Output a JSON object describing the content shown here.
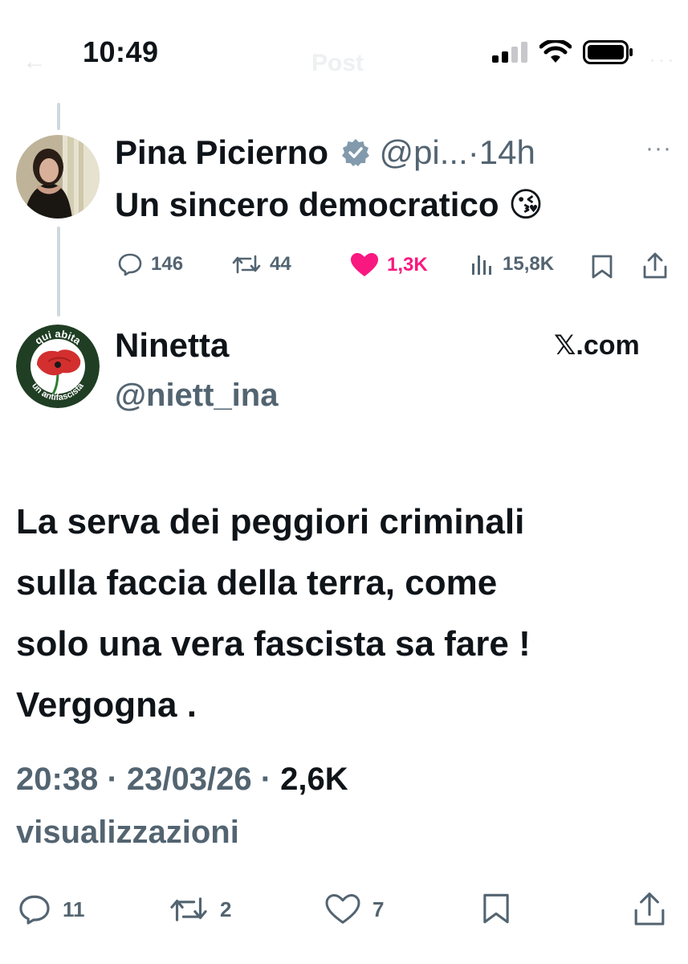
{
  "status_bar": {
    "time": "10:49"
  },
  "header_faded": {
    "back_glyph": "←",
    "title": "Post",
    "more_glyph": "···"
  },
  "parent_tweet": {
    "author_name": "Pina Picierno",
    "verified_icon": "verified-badge-icon",
    "handle": "@pi...",
    "separator": "·",
    "time_ago": "14h",
    "more_glyph": "···",
    "text": "Un sincero democratico",
    "emoji": "😘",
    "actions": {
      "replies": "146",
      "reposts": "44",
      "likes": "1,3K",
      "views": "15,8K"
    },
    "like_color": "#f91880"
  },
  "main_tweet": {
    "author_name": "Ninetta",
    "handle": "@niett_ina",
    "source_label": "𝕏.com",
    "avatar_text_top": "qui abita",
    "avatar_text_bottom": "un antifascista",
    "text_lines": [
      "La serva dei peggiori criminali",
      "sulla faccia della terra, come",
      "solo una vera fascista sa fare !",
      "Vergogna ."
    ],
    "time": "20:38",
    "date": "23/03/26",
    "separator": "·",
    "views_count": "2,6K",
    "views_label": "visualizzazioni",
    "actions": {
      "replies": "11",
      "reposts": "2",
      "likes": "7"
    }
  },
  "colors": {
    "text_primary": "#0f1419",
    "text_secondary": "#536471",
    "thread_line": "#cfd9de",
    "verified": "#829aab"
  }
}
